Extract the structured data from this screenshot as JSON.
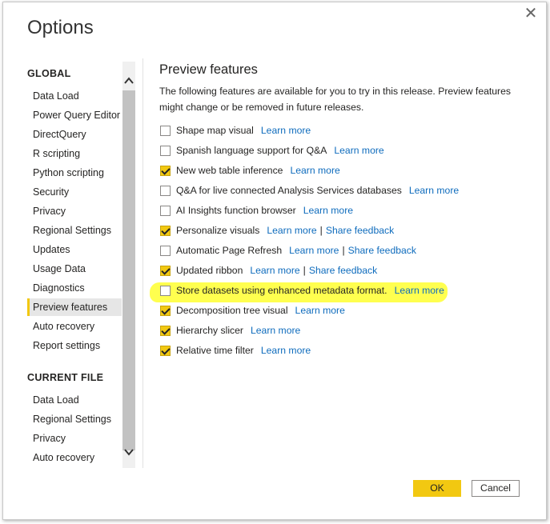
{
  "dialog": {
    "title": "Options",
    "close_glyph": "✕"
  },
  "nav": {
    "global_heading": "GLOBAL",
    "global_items": [
      "Data Load",
      "Power Query Editor",
      "DirectQuery",
      "R scripting",
      "Python scripting",
      "Security",
      "Privacy",
      "Regional Settings",
      "Updates",
      "Usage Data",
      "Diagnostics",
      "Preview features",
      "Auto recovery",
      "Report settings"
    ],
    "selected_item": "Preview features",
    "current_file_heading": "CURRENT FILE",
    "current_file_items": [
      "Data Load",
      "Regional Settings",
      "Privacy",
      "Auto recovery"
    ]
  },
  "content": {
    "title": "Preview features",
    "description": "The following features are available for you to try in this release. Preview features might change or be removed in future releases.",
    "features": [
      {
        "label": "Shape map visual",
        "checked": false,
        "links": [
          "Learn more"
        ]
      },
      {
        "label": "Spanish language support for Q&A",
        "checked": false,
        "links": [
          "Learn more"
        ]
      },
      {
        "label": "New web table inference",
        "checked": true,
        "links": [
          "Learn more"
        ]
      },
      {
        "label": "Q&A for live connected Analysis Services databases",
        "checked": false,
        "links": [
          "Learn more"
        ]
      },
      {
        "label": "AI Insights function browser",
        "checked": false,
        "links": [
          "Learn more"
        ]
      },
      {
        "label": "Personalize visuals",
        "checked": true,
        "links": [
          "Learn more",
          "Share feedback"
        ]
      },
      {
        "label": "Automatic Page Refresh",
        "checked": false,
        "links": [
          "Learn more",
          "Share feedback"
        ]
      },
      {
        "label": "Updated ribbon",
        "checked": true,
        "links": [
          "Learn more",
          "Share feedback"
        ]
      },
      {
        "label": "Store datasets using enhanced metadata format.",
        "checked": false,
        "links": [
          "Learn more"
        ],
        "highlighted": true
      },
      {
        "label": "Decomposition tree visual",
        "checked": true,
        "links": [
          "Learn more"
        ]
      },
      {
        "label": "Hierarchy slicer",
        "checked": true,
        "links": [
          "Learn more"
        ]
      },
      {
        "label": "Relative time filter",
        "checked": true,
        "links": [
          "Learn more"
        ]
      }
    ],
    "link_separator": "|"
  },
  "buttons": {
    "ok_label": "OK",
    "cancel_label": "Cancel"
  },
  "colors": {
    "accent": "#f2c811",
    "link": "#0f6cbd",
    "highlight": "#ffff3c"
  },
  "scrollbar": {
    "up_glyph": "⌃",
    "down_glyph": "⌄"
  }
}
